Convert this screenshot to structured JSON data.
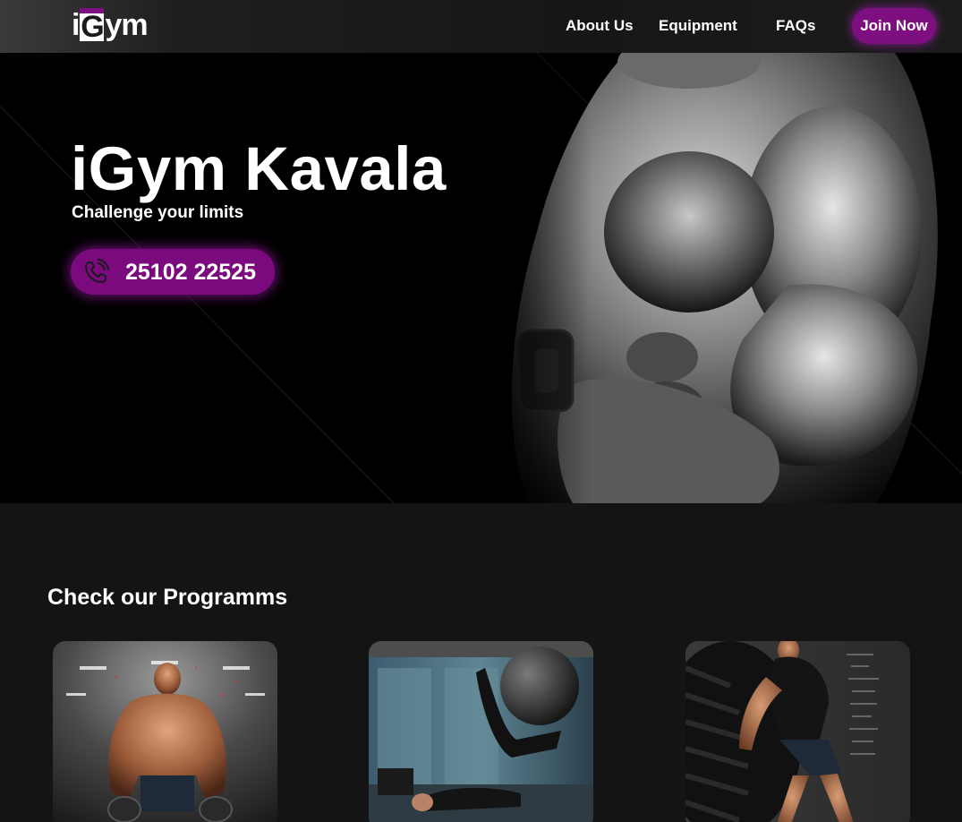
{
  "brand": {
    "logo_i": "i",
    "logo_g": "G",
    "logo_ym": "ym",
    "accent": "#7d0f80"
  },
  "nav": {
    "about_label": "About Us",
    "equipment_label": "Equipment",
    "faqs_label": "FAQs",
    "join_label": "Join Now"
  },
  "hero": {
    "title": "iGym Kavala",
    "subtitle": "Challenge your limits",
    "phone_number": "25102 22525",
    "phone_icon": "phone-call-icon"
  },
  "programs": {
    "heading": "Check our Programms",
    "cards": [
      {
        "image": "bodybuilder-photo"
      },
      {
        "image": "pilates-ball-photo"
      },
      {
        "image": "tire-flip-photo"
      }
    ]
  }
}
